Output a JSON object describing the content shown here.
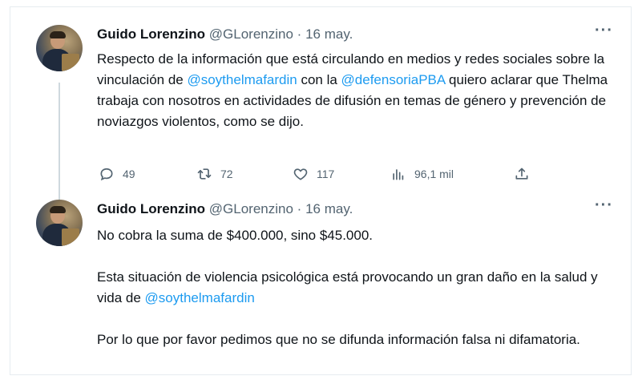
{
  "tweets": [
    {
      "author": {
        "name": "Guido Lorenzino",
        "handle": "@GLorenzino",
        "separator": "·",
        "date": "16 may."
      },
      "more_label": "···",
      "text": {
        "p1_a": "Respecto de la información que está circulando en medios y redes sociales sobre la vinculación de ",
        "mention1": "@soythelmafardin",
        "p1_b": " con la ",
        "mention2": "@defensoriaPBA",
        "p1_c": " quiero aclarar que Thelma trabaja con nosotros en actividades de difusión en temas de género y prevención de noviazgos violentos, como se dijo."
      },
      "stats": {
        "replies": "49",
        "retweets": "72",
        "likes": "117",
        "views": "96,1 mil"
      },
      "icons": [
        "reply-icon",
        "retweet-icon",
        "like-icon",
        "views-icon",
        "share-icon"
      ]
    },
    {
      "author": {
        "name": "Guido Lorenzino",
        "handle": "@GLorenzino",
        "separator": "·",
        "date": "16 may."
      },
      "more_label": "···",
      "text": {
        "p1": "No cobra la suma de $400.000, sino $45.000.",
        "p2_a": "Esta situación de violencia psicológica está provocando un gran daño en la salud y vida de ",
        "mention1": "@soythelmafardin",
        "p3": "Por lo que por favor pedimos que no se difunda información falsa ni difamatoria."
      }
    }
  ],
  "colors": {
    "mention": "#1d9bf0",
    "secondary_text": "#536471",
    "primary_text": "#0f1419",
    "thread_line": "#cfd9de"
  }
}
